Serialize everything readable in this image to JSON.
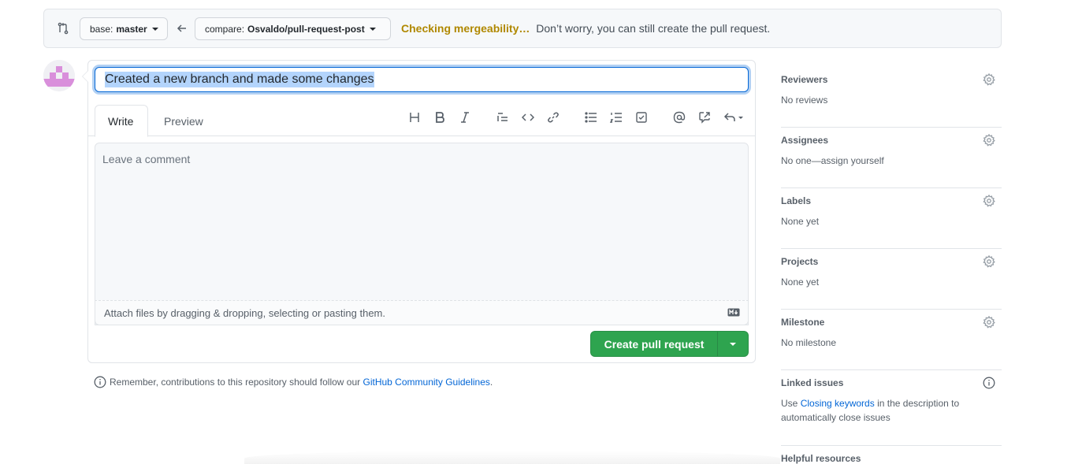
{
  "compare_bar": {
    "base_prefix": "base:",
    "base_value": "master",
    "compare_prefix": "compare:",
    "compare_value": "Osvaldo/pull-request-post",
    "status_checking": "Checking mergeability…",
    "status_message": "Don’t worry, you can still create the pull request."
  },
  "editor": {
    "title_value": "Created a new branch and made some changes",
    "tabs": [
      {
        "label": "Write",
        "active": true
      },
      {
        "label": "Preview",
        "active": false
      }
    ],
    "toolbar_icons": [
      "heading-icon",
      "bold-icon",
      "italic-icon",
      "quote-icon",
      "code-icon",
      "link-icon",
      "unordered-list-icon",
      "ordered-list-icon",
      "task-list-icon",
      "mention-icon",
      "reference-icon",
      "reply-icon"
    ],
    "comment_placeholder": "Leave a comment",
    "attach_text": "Attach files by dragging & dropping, selecting or pasting them.",
    "create_button_label": "Create pull request",
    "accent_color": "#2ea44f"
  },
  "reminder": {
    "text": "Remember, contributions to this repository should follow our",
    "link": "GitHub Community Guidelines",
    "end": "."
  },
  "sidebar": {
    "reviewers": {
      "title": "Reviewers",
      "value": "No reviews"
    },
    "assignees": {
      "title": "Assignees",
      "value": "No one—assign yourself"
    },
    "labels": {
      "title": "Labels",
      "value": "None yet"
    },
    "projects": {
      "title": "Projects",
      "value": "None yet"
    },
    "milestone": {
      "title": "Milestone",
      "value": "No milestone"
    },
    "linked_issues": {
      "title": "Linked issues",
      "pre": "Use",
      "link": "Closing keywords",
      "post": "in the description to automatically close issues"
    },
    "helpful": {
      "title": "Helpful resources"
    }
  }
}
